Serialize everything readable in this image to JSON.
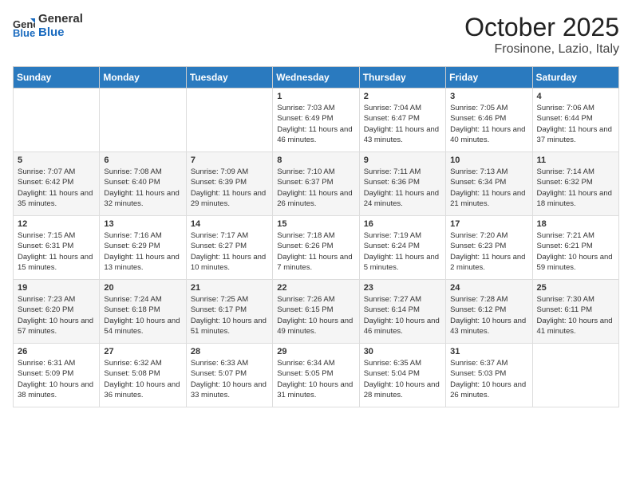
{
  "header": {
    "logo_line1": "General",
    "logo_line2": "Blue",
    "title": "October 2025",
    "subtitle": "Frosinone, Lazio, Italy"
  },
  "weekdays": [
    "Sunday",
    "Monday",
    "Tuesday",
    "Wednesday",
    "Thursday",
    "Friday",
    "Saturday"
  ],
  "weeks": [
    [
      {
        "day": "",
        "info": ""
      },
      {
        "day": "",
        "info": ""
      },
      {
        "day": "",
        "info": ""
      },
      {
        "day": "1",
        "info": "Sunrise: 7:03 AM\nSunset: 6:49 PM\nDaylight: 11 hours and 46 minutes."
      },
      {
        "day": "2",
        "info": "Sunrise: 7:04 AM\nSunset: 6:47 PM\nDaylight: 11 hours and 43 minutes."
      },
      {
        "day": "3",
        "info": "Sunrise: 7:05 AM\nSunset: 6:46 PM\nDaylight: 11 hours and 40 minutes."
      },
      {
        "day": "4",
        "info": "Sunrise: 7:06 AM\nSunset: 6:44 PM\nDaylight: 11 hours and 37 minutes."
      }
    ],
    [
      {
        "day": "5",
        "info": "Sunrise: 7:07 AM\nSunset: 6:42 PM\nDaylight: 11 hours and 35 minutes."
      },
      {
        "day": "6",
        "info": "Sunrise: 7:08 AM\nSunset: 6:40 PM\nDaylight: 11 hours and 32 minutes."
      },
      {
        "day": "7",
        "info": "Sunrise: 7:09 AM\nSunset: 6:39 PM\nDaylight: 11 hours and 29 minutes."
      },
      {
        "day": "8",
        "info": "Sunrise: 7:10 AM\nSunset: 6:37 PM\nDaylight: 11 hours and 26 minutes."
      },
      {
        "day": "9",
        "info": "Sunrise: 7:11 AM\nSunset: 6:36 PM\nDaylight: 11 hours and 24 minutes."
      },
      {
        "day": "10",
        "info": "Sunrise: 7:13 AM\nSunset: 6:34 PM\nDaylight: 11 hours and 21 minutes."
      },
      {
        "day": "11",
        "info": "Sunrise: 7:14 AM\nSunset: 6:32 PM\nDaylight: 11 hours and 18 minutes."
      }
    ],
    [
      {
        "day": "12",
        "info": "Sunrise: 7:15 AM\nSunset: 6:31 PM\nDaylight: 11 hours and 15 minutes."
      },
      {
        "day": "13",
        "info": "Sunrise: 7:16 AM\nSunset: 6:29 PM\nDaylight: 11 hours and 13 minutes."
      },
      {
        "day": "14",
        "info": "Sunrise: 7:17 AM\nSunset: 6:27 PM\nDaylight: 11 hours and 10 minutes."
      },
      {
        "day": "15",
        "info": "Sunrise: 7:18 AM\nSunset: 6:26 PM\nDaylight: 11 hours and 7 minutes."
      },
      {
        "day": "16",
        "info": "Sunrise: 7:19 AM\nSunset: 6:24 PM\nDaylight: 11 hours and 5 minutes."
      },
      {
        "day": "17",
        "info": "Sunrise: 7:20 AM\nSunset: 6:23 PM\nDaylight: 11 hours and 2 minutes."
      },
      {
        "day": "18",
        "info": "Sunrise: 7:21 AM\nSunset: 6:21 PM\nDaylight: 10 hours and 59 minutes."
      }
    ],
    [
      {
        "day": "19",
        "info": "Sunrise: 7:23 AM\nSunset: 6:20 PM\nDaylight: 10 hours and 57 minutes."
      },
      {
        "day": "20",
        "info": "Sunrise: 7:24 AM\nSunset: 6:18 PM\nDaylight: 10 hours and 54 minutes."
      },
      {
        "day": "21",
        "info": "Sunrise: 7:25 AM\nSunset: 6:17 PM\nDaylight: 10 hours and 51 minutes."
      },
      {
        "day": "22",
        "info": "Sunrise: 7:26 AM\nSunset: 6:15 PM\nDaylight: 10 hours and 49 minutes."
      },
      {
        "day": "23",
        "info": "Sunrise: 7:27 AM\nSunset: 6:14 PM\nDaylight: 10 hours and 46 minutes."
      },
      {
        "day": "24",
        "info": "Sunrise: 7:28 AM\nSunset: 6:12 PM\nDaylight: 10 hours and 43 minutes."
      },
      {
        "day": "25",
        "info": "Sunrise: 7:30 AM\nSunset: 6:11 PM\nDaylight: 10 hours and 41 minutes."
      }
    ],
    [
      {
        "day": "26",
        "info": "Sunrise: 6:31 AM\nSunset: 5:09 PM\nDaylight: 10 hours and 38 minutes."
      },
      {
        "day": "27",
        "info": "Sunrise: 6:32 AM\nSunset: 5:08 PM\nDaylight: 10 hours and 36 minutes."
      },
      {
        "day": "28",
        "info": "Sunrise: 6:33 AM\nSunset: 5:07 PM\nDaylight: 10 hours and 33 minutes."
      },
      {
        "day": "29",
        "info": "Sunrise: 6:34 AM\nSunset: 5:05 PM\nDaylight: 10 hours and 31 minutes."
      },
      {
        "day": "30",
        "info": "Sunrise: 6:35 AM\nSunset: 5:04 PM\nDaylight: 10 hours and 28 minutes."
      },
      {
        "day": "31",
        "info": "Sunrise: 6:37 AM\nSunset: 5:03 PM\nDaylight: 10 hours and 26 minutes."
      },
      {
        "day": "",
        "info": ""
      }
    ]
  ]
}
